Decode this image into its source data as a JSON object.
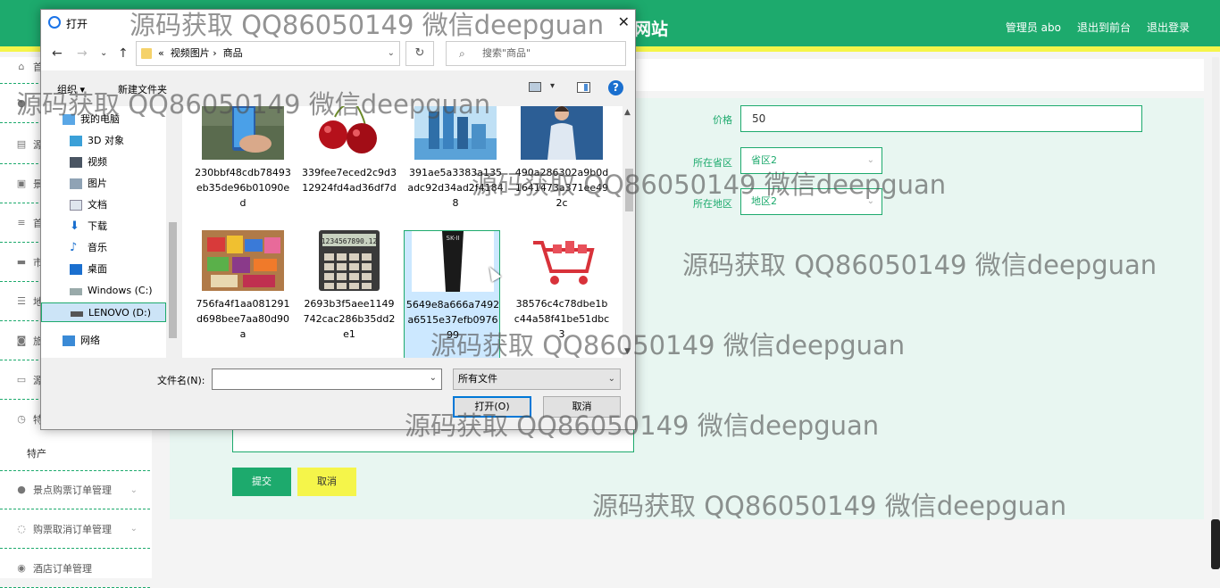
{
  "header": {
    "brand": "网站",
    "nav": [
      "管理员 abo",
      "退出到前台",
      "退出登录"
    ]
  },
  "sidebar": {
    "items": [
      {
        "label": "首",
        "icon": "home-icon"
      },
      {
        "label": "",
        "icon": "user-icon"
      },
      {
        "label": "源",
        "icon": "list-icon"
      },
      {
        "label": "景",
        "icon": "clipboard-icon"
      },
      {
        "label": "首",
        "icon": "menu-icon"
      },
      {
        "label": "市",
        "icon": "print-icon"
      },
      {
        "label": "地",
        "icon": "sliders-icon"
      },
      {
        "label": "旅",
        "icon": "ticket-icon"
      },
      {
        "label": "源",
        "icon": "comment-icon"
      },
      {
        "label": "特",
        "icon": "clock-icon"
      },
      {
        "label": "景点购票订单管理",
        "icon": "user-icon"
      },
      {
        "label": "购票取消订单管理",
        "icon": "circle-icon"
      },
      {
        "label": "酒店订单管理",
        "icon": "compass-icon"
      }
    ],
    "sub_item": "特产"
  },
  "form": {
    "price_label": "价格",
    "price_value": "50",
    "province_label": "所在省区",
    "province_value": "省区2",
    "region_label": "所在地区",
    "region_value": "地区2",
    "submit_label": "提交",
    "cancel_label": "取消"
  },
  "dialog": {
    "title": "打开",
    "address_prefix": "«",
    "address_path": [
      "视频图片",
      "商品"
    ],
    "search_placeholder": "搜索\"商品\"",
    "organize_label": "组织 ▾",
    "new_folder_label": "新建文件夹",
    "help": "?",
    "tree": [
      {
        "label": "我的电脑",
        "icon": "computer-icon"
      },
      {
        "label": "3D 对象",
        "icon": "cube-icon"
      },
      {
        "label": "视频",
        "icon": "video-icon"
      },
      {
        "label": "图片",
        "icon": "picture-icon"
      },
      {
        "label": "文档",
        "icon": "document-icon"
      },
      {
        "label": "下载",
        "icon": "download-icon"
      },
      {
        "label": "音乐",
        "icon": "music-icon"
      },
      {
        "label": "桌面",
        "icon": "desktop-icon"
      },
      {
        "label": "Windows (C:)",
        "icon": "drive-icon"
      },
      {
        "label": "LENOVO (D:)",
        "icon": "drive-icon"
      },
      {
        "label": "网络",
        "icon": "network-icon"
      }
    ],
    "files": [
      {
        "name": "230bbf48cdb78493eb35de96b01090ed",
        "thumb": "phone-photo"
      },
      {
        "name": "339fee7eced2c9d312924fd4ad36df7d",
        "thumb": "cherry-photo"
      },
      {
        "name": "391ae5a3383a135adc92d34ad2f41848",
        "thumb": "cosmetics-photo"
      },
      {
        "name": "490a286302a9b0d1641473a371ee492c",
        "thumb": "woman-photo"
      },
      {
        "name": "756fa4f1aa081291d698bee7aa80d90a",
        "thumb": "snacks-photo"
      },
      {
        "name": "2693b3f5aee1149742cac286b35dd2e1",
        "thumb": "calculator-photo"
      },
      {
        "name": "5649e8a666a7492a6515e37efb097699",
        "thumb": "skincare-photo"
      },
      {
        "name": "38576c4c78dbe1bc44a58f41be51dbc3",
        "thumb": "cart-photo"
      }
    ],
    "calculator_display": "1234567890.12",
    "skii_text": "SK-II",
    "filename_label": "文件名(N):",
    "filename_value": "",
    "filetype_value": "所有文件",
    "open_label": "打开(O)",
    "cancel_label": "取消"
  },
  "watermark": "源码获取 QQ86050149 微信deepguan",
  "colors": {
    "primary": "#1daa6d",
    "accent": "#f5f54a",
    "panel": "#e8f6f1"
  }
}
